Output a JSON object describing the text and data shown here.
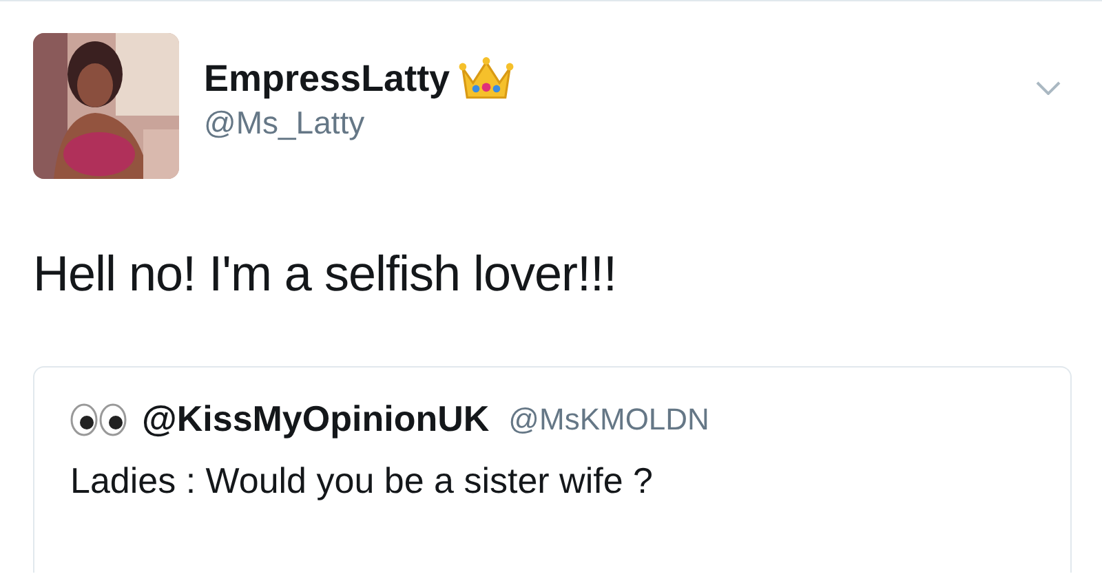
{
  "tweet": {
    "author": {
      "name": "EmpressLatty",
      "handle": "@Ms_Latty"
    },
    "text": "Hell no! I'm a selfish lover!!!",
    "quoted": {
      "name": "@KissMyOpinionUK",
      "handle": "@MsKMOLDN",
      "text": "Ladies : Would you be a sister wife ?"
    }
  }
}
